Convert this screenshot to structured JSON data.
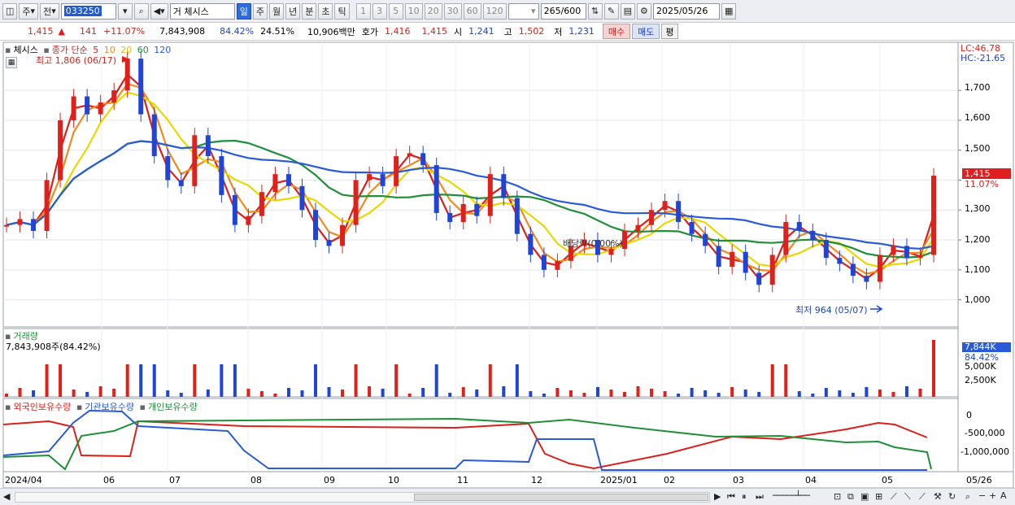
{
  "toolbar": {
    "type_label": "주",
    "type2_label": "전",
    "code": "033250",
    "stock_prefix": "거",
    "stock_name": "체시스",
    "periods": [
      "일",
      "주",
      "월",
      "년",
      "분",
      "초",
      "틱"
    ],
    "selected_period": "일",
    "intervals": [
      "1",
      "3",
      "5",
      "10",
      "20",
      "30",
      "60",
      "120"
    ],
    "count": "265",
    "count_max": "/600",
    "date": "2025/05/26"
  },
  "quote": {
    "price": "1,415",
    "change_arrow": "▲",
    "change": "141",
    "change_pct": "+11.07%",
    "volume": "7,843,908",
    "vol_ratio": "84.42%",
    "turnover": "24.51%",
    "amount": "10,906백만",
    "bid_label": "호가",
    "bid1": "1,416",
    "bid2": "1,415",
    "open_label": "시",
    "open": "1,241",
    "high_label": "고",
    "high": "1,502",
    "low_label": "저",
    "low": "1,231",
    "buy_label": "매수",
    "sell_label": "매도",
    "eval_label": "평"
  },
  "price_panel": {
    "name": "체시스",
    "ma_title": "종가 단순",
    "ma_periods": [
      "5",
      "10",
      "20",
      "60",
      "120"
    ],
    "ma_colors": [
      "#d9201b",
      "#f08a1c",
      "#e8d800",
      "#1f8f3a",
      "#2a5bd7"
    ],
    "high_note": "최고 1,806 (06/17)",
    "low_note": "최저 964 (05/07)",
    "dividend_note": "배당락(0.00%)",
    "lc": "LC:46.78",
    "hc": "HC:-21.65",
    "y_ticks": [
      "1,700",
      "1,600",
      "1,500",
      "1,400",
      "1,300",
      "1,200",
      "1,100",
      "1,000"
    ],
    "price_tag": "1,415",
    "pct_tag": "11.07%"
  },
  "volume_panel": {
    "title": "거래량",
    "value": "7,843,908주(84.42%)",
    "tag": "7,844K",
    "pct_tag": "84.42%",
    "y_ticks": [
      "5,000K",
      "2,500K"
    ]
  },
  "holdings_panel": {
    "series": [
      "외국인보유수량",
      "기관보유수량",
      "개인보유수량"
    ],
    "colors": [
      "#d9201b",
      "#2a5bd7",
      "#1f8f3a"
    ],
    "y_ticks": [
      "0",
      "-500,000",
      "-1,000,000"
    ]
  },
  "x_axis": {
    "labels": [
      "2024/04",
      "06",
      "07",
      "08",
      "09",
      "10",
      "11",
      "12",
      "2025/01",
      "02",
      "03",
      "04",
      "05",
      "05/26"
    ]
  },
  "chart_data": {
    "type": "line",
    "title": "체시스",
    "series": [
      {
        "name": "종가",
        "values": [
          1250,
          1270,
          1230,
          1400,
          1600,
          1680,
          1620,
          1660,
          1700,
          1806,
          1620,
          1480,
          1400,
          1380,
          1550,
          1480,
          1350,
          1250,
          1280,
          1360,
          1420,
          1380,
          1300,
          1200,
          1180,
          1250,
          1400,
          1420,
          1380,
          1480,
          1490,
          1450,
          1290,
          1260,
          1320,
          1280,
          1420,
          1340,
          1220,
          1150,
          1100,
          1130,
          1180,
          1200,
          1150,
          1170,
          1230,
          1250,
          1300,
          1330,
          1260,
          1220,
          1180,
          1110,
          1160,
          1090,
          1050,
          1150,
          1260,
          1230,
          1200,
          1140,
          1120,
          1080,
          1060,
          1150,
          1180,
          1140,
          1150,
          1415
        ]
      }
    ],
    "ylim": [
      950,
      1820
    ]
  }
}
